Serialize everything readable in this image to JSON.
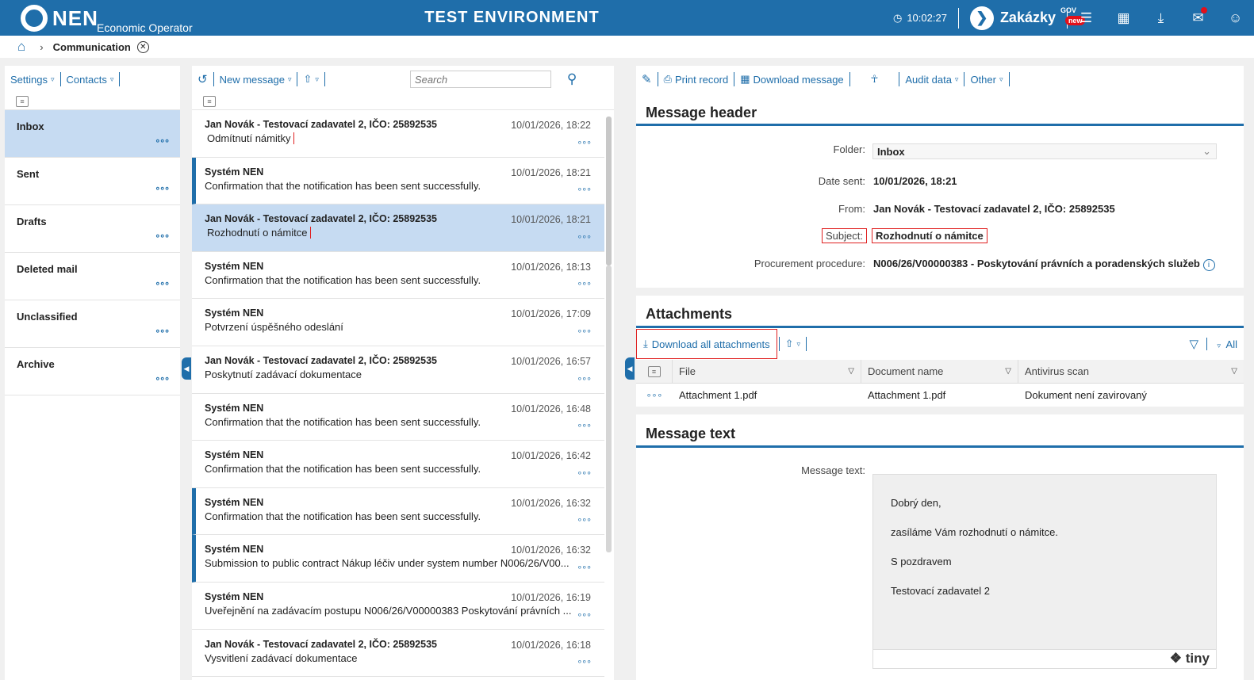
{
  "topbar": {
    "brand": "NEN",
    "brand_sub": "Economic Operator",
    "environment": "TEST ENVIRONMENT",
    "time": "10:02:27",
    "zakazky": "Zakázky",
    "gov": "GOV",
    "new_badge": "new"
  },
  "breadcrumb": {
    "current": "Communication"
  },
  "folders_panel": {
    "settings": "Settings",
    "contacts": "Contacts",
    "folders": [
      "Inbox",
      "Sent",
      "Drafts",
      "Deleted mail",
      "Unclassified",
      "Archive"
    ],
    "selected": "Inbox"
  },
  "messages_panel": {
    "new_message": "New message",
    "search_placeholder": "Search",
    "messages": [
      {
        "sender": "Jan Novák - Testovací zadavatel 2, IČO: 25892535",
        "date": "10/01/2026, 18:22",
        "subject": "Odmítnutí námitky"
      },
      {
        "sender": "Systém NEN",
        "date": "10/01/2026, 18:21",
        "subject": "Confirmation that the notification has been sent successfully."
      },
      {
        "sender": "Jan Novák - Testovací zadavatel 2, IČO: 25892535",
        "date": "10/01/2026, 18:21",
        "subject": "Rozhodnutí o námitce"
      },
      {
        "sender": "Systém NEN",
        "date": "10/01/2026, 18:13",
        "subject": "Confirmation that the notification has been sent successfully."
      },
      {
        "sender": "Systém NEN",
        "date": "10/01/2026, 17:09",
        "subject": "Potvrzení úspěšného odeslání"
      },
      {
        "sender": "Jan Novák - Testovací zadavatel 2, IČO: 25892535",
        "date": "10/01/2026, 16:57",
        "subject": "Poskytnutí zadávací dokumentace"
      },
      {
        "sender": "Systém NEN",
        "date": "10/01/2026, 16:48",
        "subject": "Confirmation that the notification has been sent successfully."
      },
      {
        "sender": "Systém NEN",
        "date": "10/01/2026, 16:42",
        "subject": "Confirmation that the notification has been sent successfully."
      },
      {
        "sender": "Systém NEN",
        "date": "10/01/2026, 16:32",
        "subject": "Confirmation that the notification has been sent successfully."
      },
      {
        "sender": "Systém NEN",
        "date": "10/01/2026, 16:32",
        "subject": "Submission to public contract Nákup léčiv under system number N006/26/V00..."
      },
      {
        "sender": "Systém NEN",
        "date": "10/01/2026, 16:19",
        "subject": "Uveřejnění na zadávacím postupu N006/26/V00000383 Poskytování právních ..."
      },
      {
        "sender": "Jan Novák - Testovací zadavatel 2, IČO: 25892535",
        "date": "10/01/2026, 16:18",
        "subject": "Vysvitlení zadávací dokumentace"
      }
    ]
  },
  "detail": {
    "toolbar": {
      "print": "Print record",
      "download": "Download message",
      "audit": "Audit data",
      "other": "Other"
    },
    "header_title": "Message header",
    "folder_label": "Folder:",
    "folder_value": "Inbox",
    "date_label": "Date sent:",
    "date_value": "10/01/2026, 18:21",
    "from_label": "From:",
    "from_value": "Jan Novák - Testovací zadavatel 2, IČO: 25892535",
    "subject_label": "Subject:",
    "subject_value": "Rozhodnutí o námitce",
    "procedure_label": "Procurement procedure:",
    "procedure_value": "N006/26/V00000383 - Poskytování právních a poradenských služeb",
    "attachments_title": "Attachments",
    "download_all": "Download all attachments",
    "filter_all": "All",
    "columns": [
      "File",
      "Document name",
      "Antivirus scan"
    ],
    "attachment": {
      "file": "Attachment 1.pdf",
      "name": "Attachment 1.pdf",
      "scan": "Dokument není zavirovaný"
    },
    "text_title": "Message text",
    "text_label": "Message text:",
    "body": [
      "Dobrý den,",
      "zasíláme Vám rozhodnutí o námitce.",
      "S pozdravem",
      "Testovací zadavatel 2"
    ],
    "editor_brand": "tiny"
  },
  "colors": {
    "primary": "#1f6eaa",
    "selected": "#c6dbf2",
    "highlight": "#e02020"
  }
}
